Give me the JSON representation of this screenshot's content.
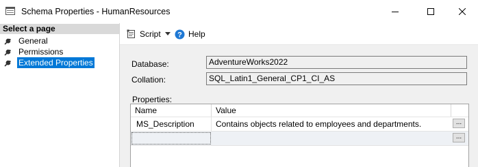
{
  "window": {
    "title": "Schema Properties - HumanResources",
    "controls": {
      "minimize": "minimize",
      "maximize": "maximize",
      "close": "close"
    }
  },
  "left_pane": {
    "header": "Select a page",
    "pages": [
      {
        "label": "General",
        "icon": "wrench-icon",
        "selected": false
      },
      {
        "label": "Permissions",
        "icon": "wrench-icon",
        "selected": false
      },
      {
        "label": "Extended Properties",
        "icon": "wrench-icon",
        "selected": true
      }
    ]
  },
  "toolbar": {
    "script_label": "Script",
    "help_label": "Help"
  },
  "form": {
    "database_label": "Database:",
    "database_value": "AdventureWorks2022",
    "collation_label": "Collation:",
    "collation_value": "SQL_Latin1_General_CP1_CI_AS",
    "properties_label": "Properties:"
  },
  "properties_grid": {
    "columns": [
      "Name",
      "Value"
    ],
    "rows": [
      {
        "name": "MS_Description",
        "value": "Contains objects related to employees and departments.",
        "button": "..."
      },
      {
        "name": "",
        "value": "",
        "button": "..."
      }
    ]
  },
  "colors": {
    "selection": "#0078d7",
    "help_icon": "#1e78d4",
    "content_background": "#f0f0f0",
    "header_background": "#d9d9d9"
  }
}
